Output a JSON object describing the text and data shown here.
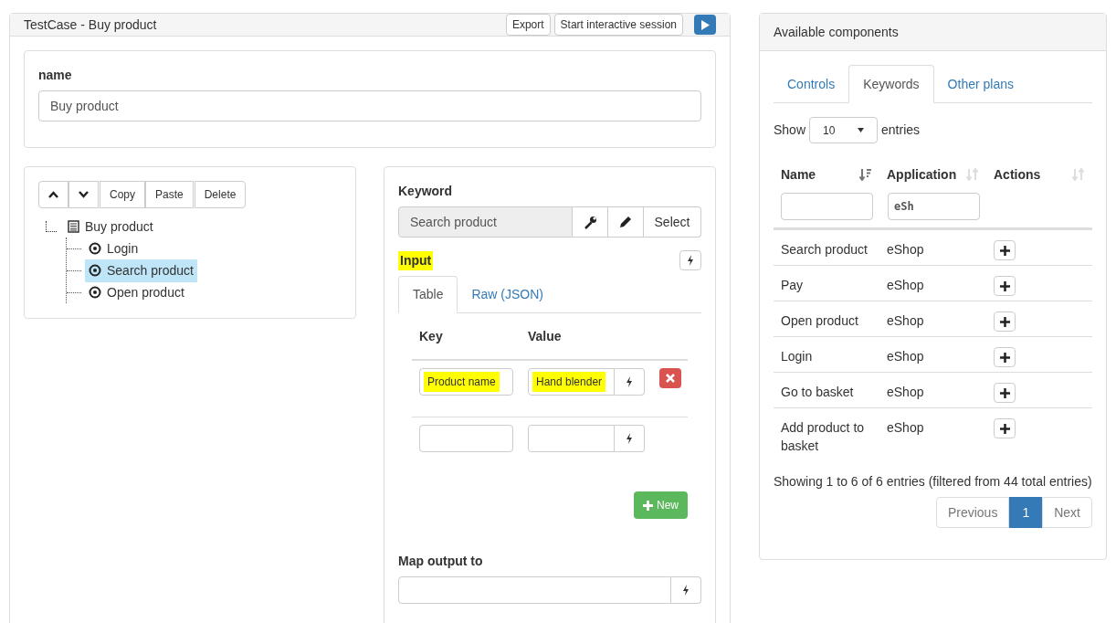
{
  "editor": {
    "title": "TestCase - Buy product",
    "buttons": [
      "Export",
      "Start interactive session"
    ],
    "name_field": {
      "label": "name",
      "value": "Buy product"
    },
    "tree_toolbar": [
      {
        "kind": "up"
      },
      {
        "kind": "down"
      },
      {
        "kind": "text",
        "label": "Copy"
      },
      {
        "kind": "text",
        "label": "Paste"
      },
      {
        "kind": "text",
        "label": "Delete"
      }
    ],
    "tree": [
      {
        "label": "Buy product",
        "kind": "plan",
        "selected": false,
        "children": [
          {
            "label": "Login",
            "kind": "call",
            "selected": false
          },
          {
            "label": "Search product",
            "kind": "call",
            "selected": true
          },
          {
            "label": "Open product",
            "kind": "call",
            "selected": false
          }
        ]
      }
    ],
    "keyword": {
      "label": "Keyword",
      "value": "Search product",
      "select_button": "Select"
    },
    "input": {
      "label": "Input",
      "highlighted": true,
      "tabs": [
        {
          "label": "Table",
          "selected": true
        },
        {
          "label": "Raw (JSON)",
          "selected": false
        }
      ],
      "columns": [
        "Key",
        "Value"
      ],
      "rows": [
        {
          "key": "Product name",
          "value": "Hand blender",
          "highlighted": true,
          "removable": true
        },
        {
          "highlighted": false,
          "removable": false
        }
      ],
      "new_button": "New"
    },
    "output": {
      "label": "Map output to"
    }
  },
  "components": {
    "title": "Available components",
    "tabs": [
      {
        "label": "Controls",
        "selected": false
      },
      {
        "label": "Keywords",
        "selected": true
      },
      {
        "label": "Other plans",
        "selected": false
      }
    ],
    "show": {
      "before": "Show",
      "value": "10",
      "after": "entries"
    },
    "columns": [
      {
        "label": "Name",
        "sorted": true,
        "filterable": true
      },
      {
        "label": "Application",
        "sorted": false,
        "filterable": true,
        "filter": "eSh"
      },
      {
        "label": "Actions",
        "sorted": false
      }
    ],
    "rows": [
      {
        "name": "Search product",
        "application": "eShop"
      },
      {
        "name": "Pay",
        "application": "eShop"
      },
      {
        "name": "Open product",
        "application": "eShop"
      },
      {
        "name": "Login",
        "application": "eShop"
      },
      {
        "name": "Go to basket",
        "application": "eShop"
      },
      {
        "name": "Add product to basket",
        "application": "eShop"
      }
    ],
    "info": "Showing 1 to 6 of 6 entries (filtered from 44 total entries)",
    "pagination": [
      {
        "label": "Previous",
        "kind": "nav",
        "selected": false
      },
      {
        "label": "1",
        "kind": "page",
        "selected": true
      },
      {
        "label": "Next",
        "kind": "nav",
        "selected": false
      }
    ]
  }
}
